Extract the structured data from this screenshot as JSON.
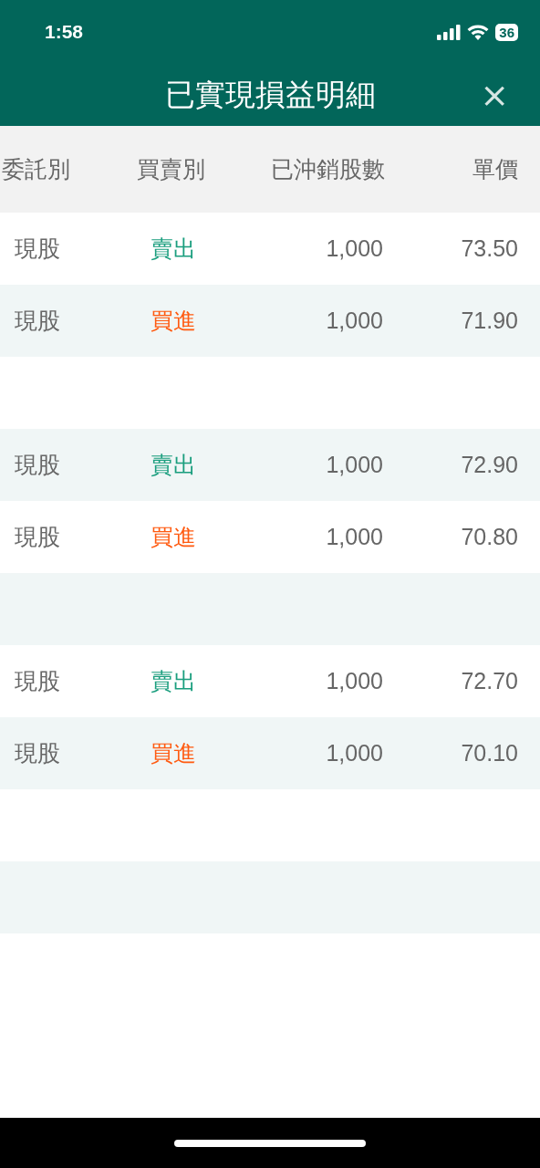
{
  "status_bar": {
    "time": "1:58",
    "battery": "36"
  },
  "header": {
    "title": "已實現損益明細",
    "close": "×"
  },
  "table": {
    "columns": [
      "委託別",
      "買賣別",
      "已沖銷股數",
      "單價"
    ],
    "rows": [
      {
        "kind": "trade",
        "type": "現股",
        "side": {
          "label": "賣出",
          "kind": "sell"
        },
        "shares": "1,000",
        "price": "73.50"
      },
      {
        "kind": "trade",
        "type": "現股",
        "side": {
          "label": "買進",
          "kind": "buy"
        },
        "shares": "1,000",
        "price": "71.90"
      },
      {
        "kind": "blank"
      },
      {
        "kind": "trade",
        "type": "現股",
        "side": {
          "label": "賣出",
          "kind": "sell"
        },
        "shares": "1,000",
        "price": "72.90"
      },
      {
        "kind": "trade",
        "type": "現股",
        "side": {
          "label": "買進",
          "kind": "buy"
        },
        "shares": "1,000",
        "price": "70.80"
      },
      {
        "kind": "blank"
      },
      {
        "kind": "trade",
        "type": "現股",
        "side": {
          "label": "賣出",
          "kind": "sell"
        },
        "shares": "1,000",
        "price": "72.70"
      },
      {
        "kind": "trade",
        "type": "現股",
        "side": {
          "label": "買進",
          "kind": "buy"
        },
        "shares": "1,000",
        "price": "70.10"
      },
      {
        "kind": "blank"
      },
      {
        "kind": "blank"
      }
    ]
  }
}
